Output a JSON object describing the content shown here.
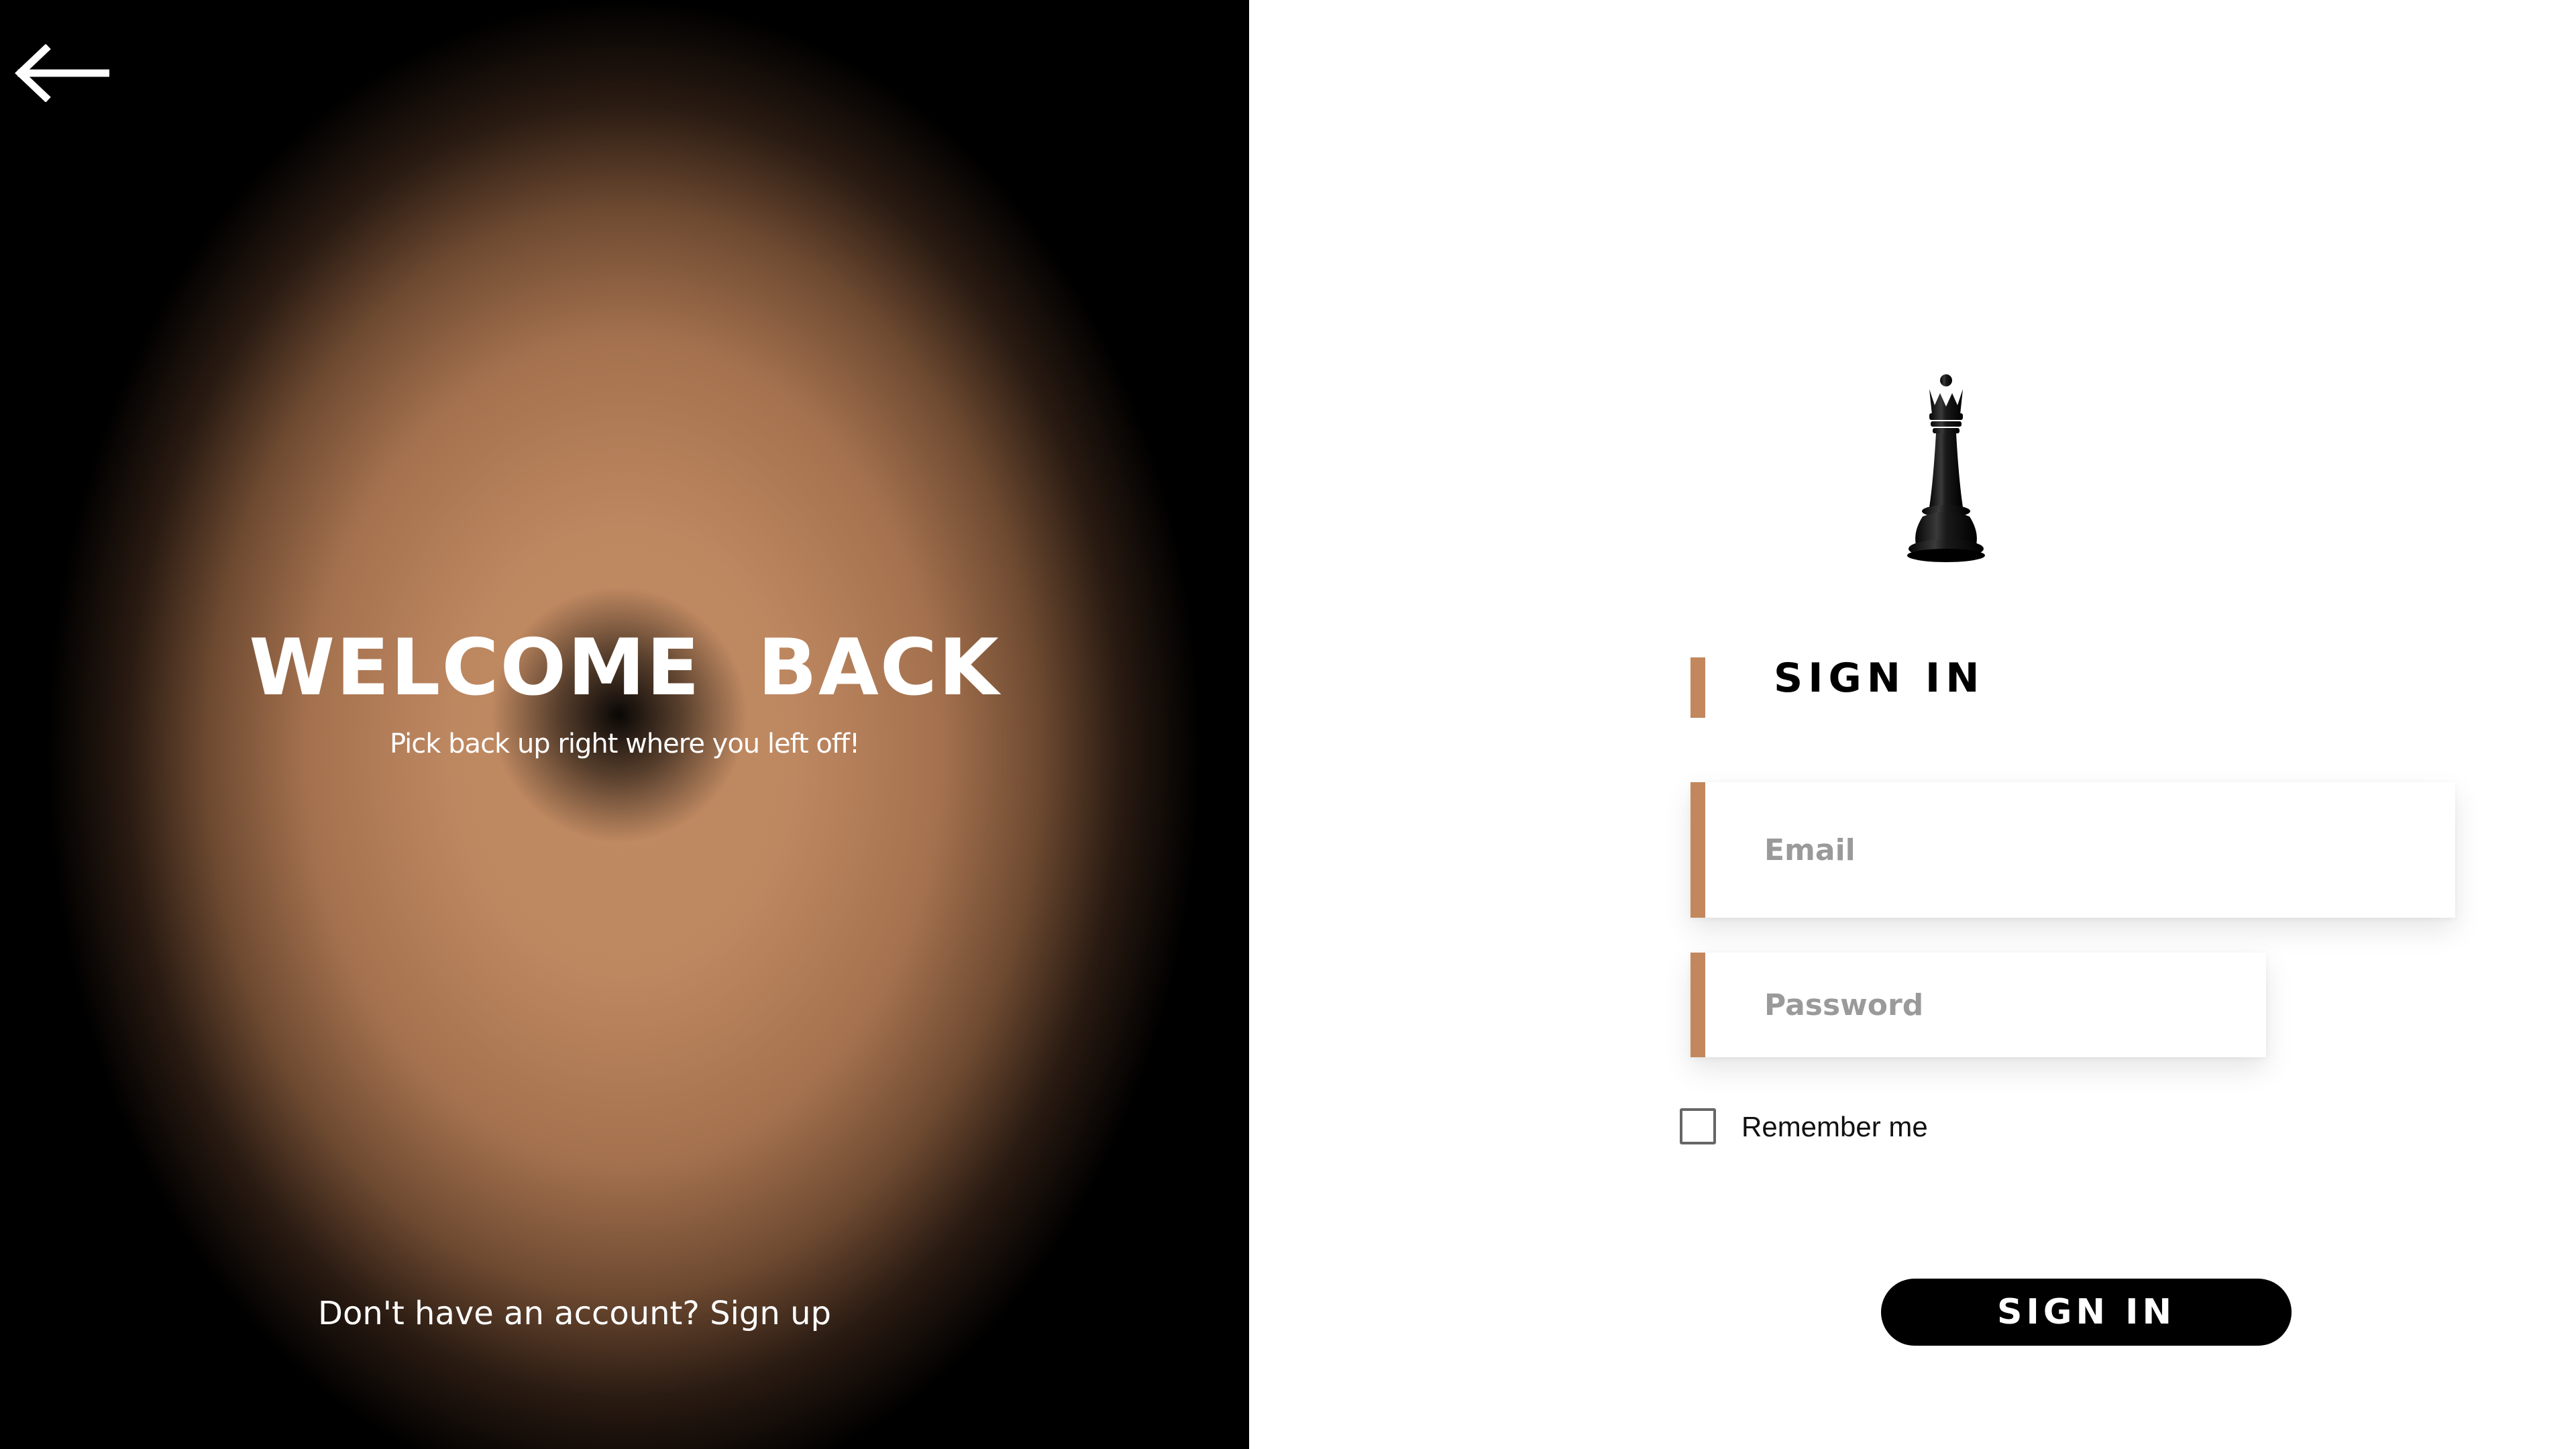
{
  "left_panel": {
    "back_icon": "arrow-left-icon",
    "title": "WELCOME  BACK",
    "subtitle": "Pick back up right where you left off!",
    "signup_text": "Don't have an account? Sign up"
  },
  "right_panel": {
    "logo_icon": "chess-queen-icon",
    "heading": "SIGN IN",
    "email": {
      "placeholder": "Email",
      "value": ""
    },
    "password": {
      "placeholder": "Password",
      "value": ""
    },
    "remember": {
      "label": "Remember me",
      "checked": false
    },
    "submit_label": "SIGN IN"
  },
  "colors": {
    "accent": "#c2875d",
    "glow": "#c08a62",
    "left_background": "#000000",
    "right_background": "#ffffff",
    "button_background": "#000000",
    "button_text": "#ffffff"
  }
}
